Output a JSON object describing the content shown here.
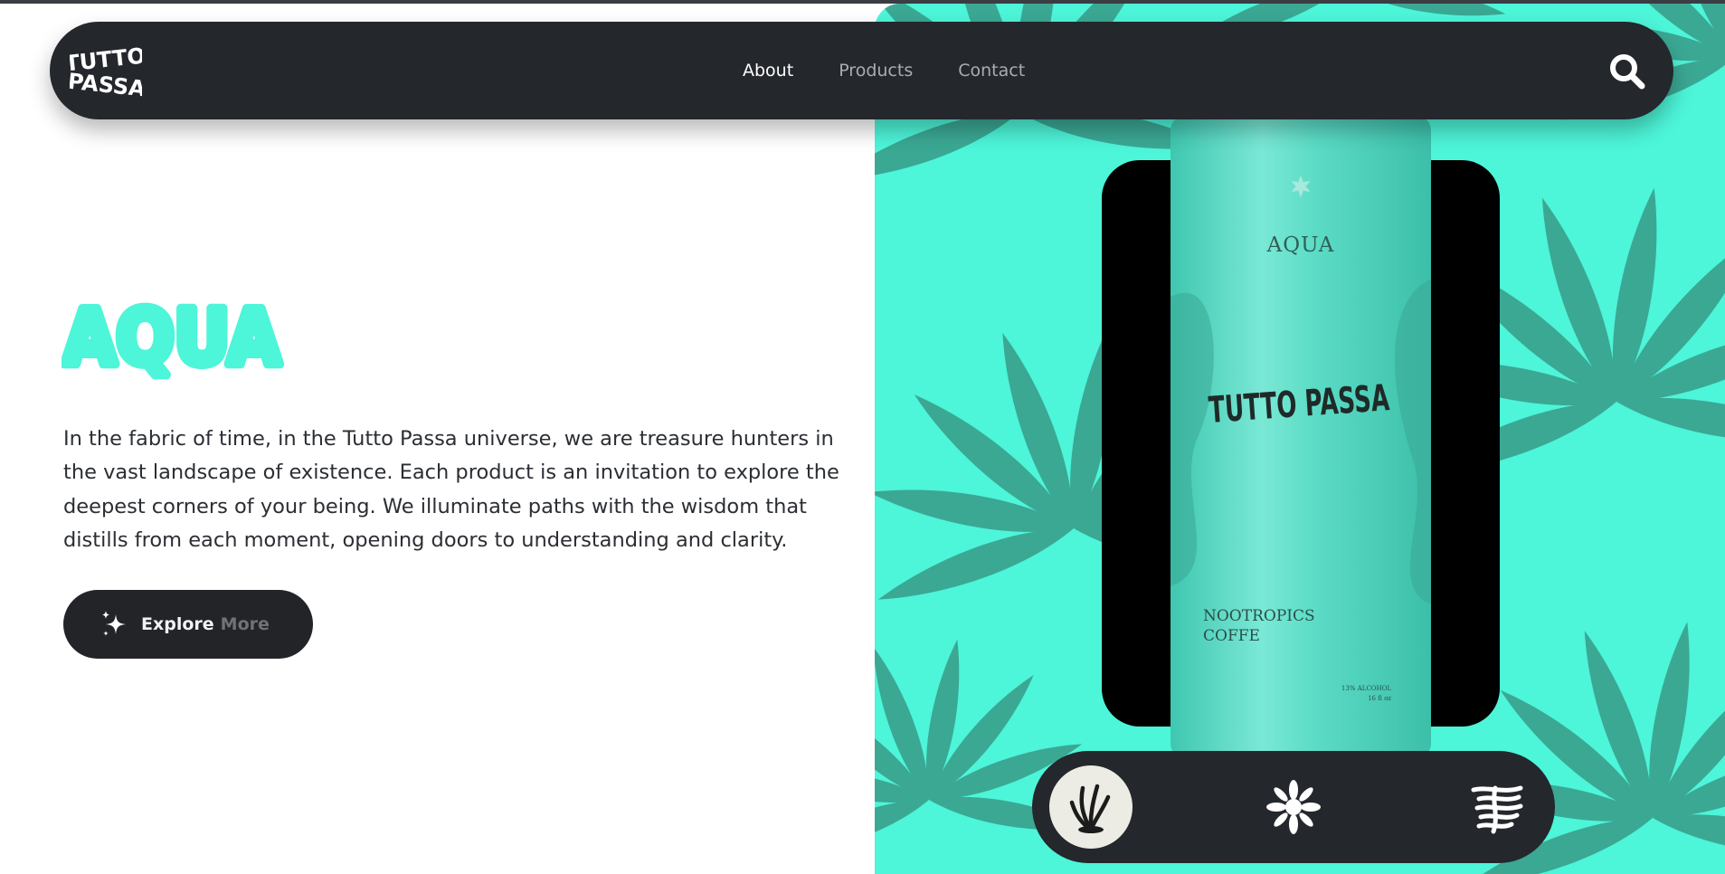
{
  "brand": {
    "logo_text": "TUTTO PASSA",
    "logo_icon": "tutto-passa-logo-icon"
  },
  "nav": {
    "links": [
      {
        "label": "About",
        "active": true
      },
      {
        "label": "Products",
        "active": false
      },
      {
        "label": "Contact",
        "active": false
      }
    ],
    "search_icon": "search-icon"
  },
  "hero": {
    "title": "AQUA",
    "description": "In the fabric of time, in the Tutto Passa universe, we are treasure hunters in the vast landscape of existence. Each product is an invitation to explore the deepest corners of your being. We illuminate paths with the wisdom that distills from each moment, opening doors to understanding and clarity.",
    "cta_primary": "Explore",
    "cta_secondary": "More",
    "cta_icon": "sparkles-icon"
  },
  "product": {
    "can_title": "AQUA",
    "can_brand": "TUTTO PASSA",
    "can_subtitle_line1": "NOOTROPICS",
    "can_subtitle_line2": "COFFE",
    "can_fine_line1": "13% ALCOHOL",
    "can_fine_line2": "16 fl oz"
  },
  "selector": {
    "items": [
      {
        "icon": "seaweed-icon",
        "active": true
      },
      {
        "icon": "coral-icon",
        "active": false
      },
      {
        "icon": "wave-lines-icon",
        "active": false
      }
    ]
  },
  "colors": {
    "accent": "#4df5d9",
    "leaf": "#3ba894",
    "nav_bg": "#24272c",
    "text": "#2b2e33",
    "can": "#5cdcc6"
  }
}
